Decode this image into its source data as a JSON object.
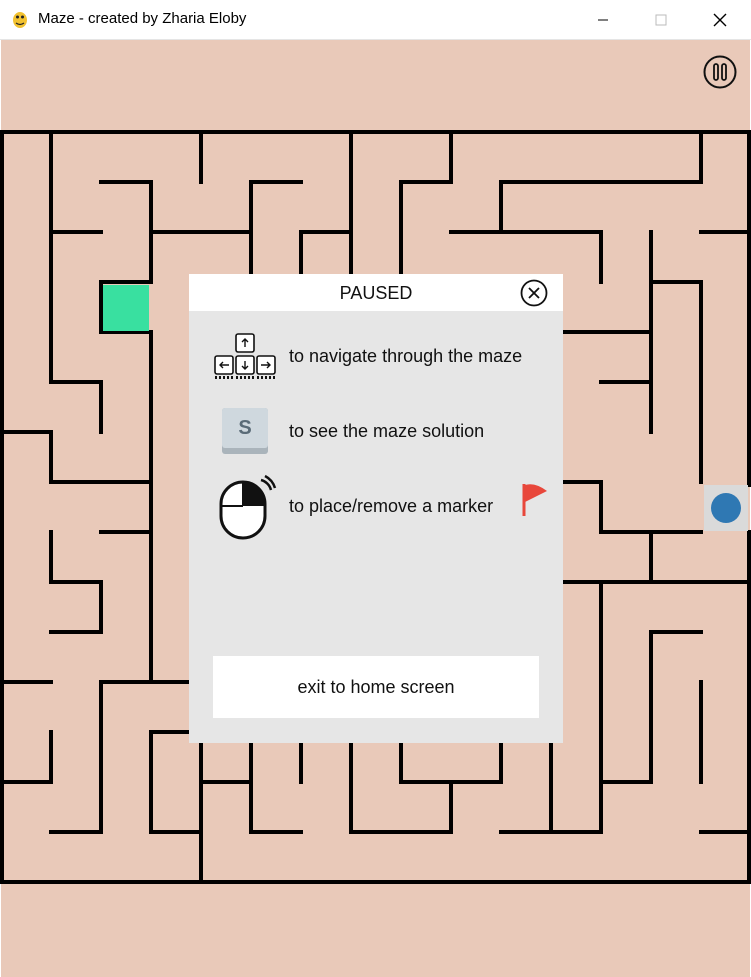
{
  "window": {
    "title": "Maze - created by Zharia Eloby",
    "controls": {
      "minimize": "—",
      "maximize": "☐",
      "close": "✕"
    }
  },
  "game": {
    "background_color": "#e9c9b9",
    "wall_color": "#000000",
    "start_color": "#39e0a0",
    "player_color": "#2f78b3"
  },
  "pause_dialog": {
    "title": "PAUSED",
    "instructions": [
      {
        "icon": "arrow-keys-icon",
        "text": "to navigate through the maze"
      },
      {
        "icon": "s-key-icon",
        "key": "S",
        "text": "to see the maze solution"
      },
      {
        "icon": "mouse-right-click-icon",
        "text": "to place/remove a marker"
      }
    ],
    "marker_icon": "red-flag-icon",
    "exit_label": "exit to home screen"
  }
}
